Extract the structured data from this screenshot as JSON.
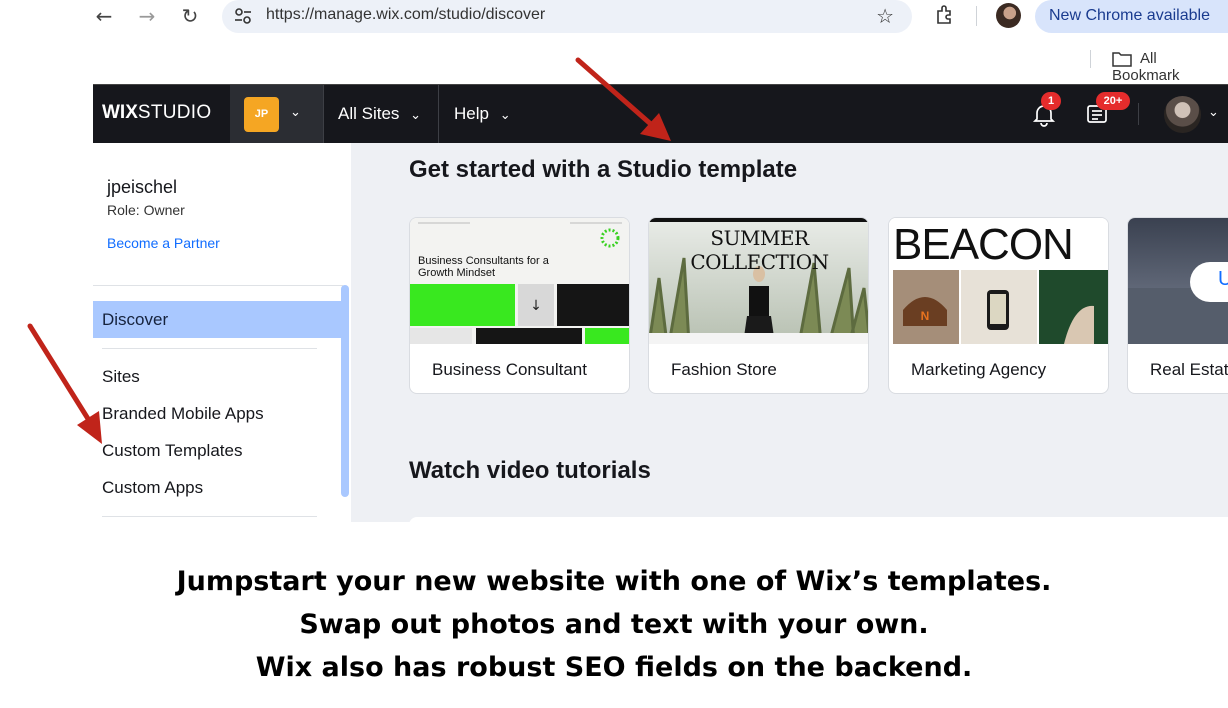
{
  "browser": {
    "url": "https://manage.wix.com/studio/discover",
    "new_chrome_label": "New Chrome available",
    "bookmarks_label": "All Bookmark",
    "icons": [
      "back-icon",
      "forward-icon",
      "reload-icon",
      "site-info-icon",
      "star-icon",
      "extensions-icon",
      "profile-avatar",
      "folder-icon"
    ]
  },
  "header": {
    "logo_wix": "WIX",
    "logo_studio": "STUDIO",
    "workspace_initials": "JP",
    "nav_all_sites": "All Sites",
    "nav_help": "Help",
    "notifications_count": "1",
    "news_count": "20+",
    "accent_color": "#f5a623",
    "badge_color": "#e52c2c"
  },
  "sidebar": {
    "user_name": "jpeischel",
    "user_role": "Role: Owner",
    "partner_link": "Become a Partner",
    "active_item": "Discover",
    "items": [
      "Sites",
      "Branded Mobile Apps",
      "Custom Templates",
      "Custom Apps"
    ],
    "active_color": "#a9c8ff"
  },
  "main": {
    "templates_title": "Get started with a Studio template",
    "templates": [
      {
        "label": "Business Consultant",
        "thumb_text": "Business Consultants for a Growth Mindset"
      },
      {
        "label": "Fashion Store",
        "thumb_text": "SUMMER COLLECTION"
      },
      {
        "label": "Marketing Agency",
        "thumb_text": "BEACON"
      },
      {
        "label": "Real Estat",
        "thumb_text": "U"
      }
    ],
    "videos_title": "Watch video tutorials"
  },
  "caption": {
    "line1": "Jumpstart your new website with one of Wix’s templates.",
    "line2": "Swap out photos and text with your own.",
    "line3": "Wix also has robust SEO fields on the backend."
  },
  "annotation_color": "#c0241a"
}
